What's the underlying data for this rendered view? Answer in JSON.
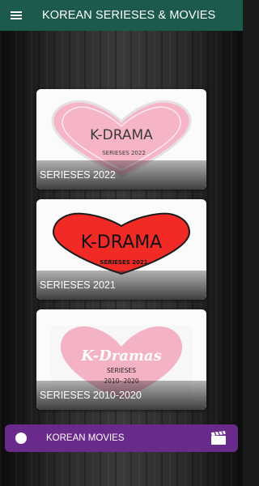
{
  "app_bar": {
    "title": "KOREAN SERIESES & MOVIES",
    "menu_icon": "hamburger-menu-icon",
    "color": "#1d5a4e"
  },
  "cards": [
    {
      "label": "SERIESES 2022",
      "art_title": "K-DRAMA",
      "art_subtitle": "SERIESES 2022",
      "heart_color": "#f5b5c7"
    },
    {
      "label": "SERIESES 2021",
      "art_title": "K-DRAMA",
      "art_subtitle": "SERIESES 2021",
      "heart_color": "#f22a26"
    },
    {
      "label": "SERIESES 2010-2020",
      "art_title": "K-Dramas",
      "art_subtitle": "SERIESES",
      "art_years": "2010- 2020",
      "heart_color": "#f4b3c5"
    }
  ],
  "bottom_bar": {
    "label": "KOREAN MOVIES",
    "icon": "clapperboard-icon",
    "color": "#6a2a8c"
  }
}
